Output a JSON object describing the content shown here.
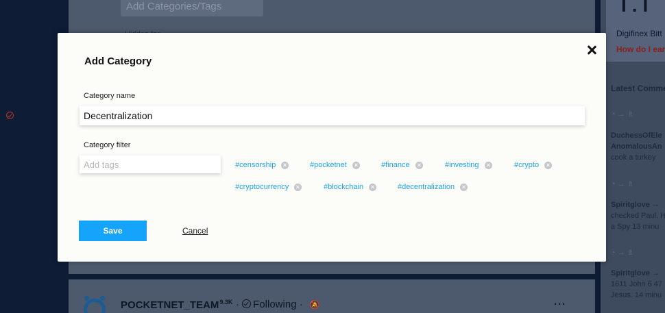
{
  "background": {
    "input_text": "Add Categories/Tags",
    "small_text": "Hidden for",
    "post": {
      "author": "POCKETNET_TEAM",
      "score": "9.3K",
      "separator": "·",
      "following": "Following",
      "bell_icon": "bell-off-icon",
      "more": "···"
    },
    "right_column": {
      "big_text": "I.I",
      "exchanges": "Digifinex  Bitt",
      "link": "How do I earn",
      "heading": "Latest Comme",
      "arrow_row": "◔ → ♗",
      "comments": [
        {
          "user": "DuchessOfEle",
          "line2": "AnomalousAn",
          "line3": "cook a turkey"
        },
        {
          "user": "Spiritglove →",
          "line2": "checked Paul, H",
          "line3": "a Spy 13 minu"
        },
        {
          "user": "Spiritglove →",
          "line2": "1611 John 6 47",
          "line3": "Jesus. 14 minu"
        }
      ]
    }
  },
  "modal": {
    "title": "Add Category",
    "close_icon": "close-icon",
    "category_name_label": "Category name",
    "category_name_value": "Decentralization",
    "category_filter_label": "Category filter",
    "tags_placeholder": "Add tags",
    "tags": [
      "#censorship",
      "#pocketnet",
      "#finance",
      "#investing",
      "#crypto",
      "#cryptocurrency",
      "#blockchain",
      "#decentralization"
    ],
    "save_label": "Save",
    "cancel_label": "Cancel"
  },
  "colors": {
    "accent": "#16a4fb",
    "tag_text": "#1fa2e6",
    "modal_bg": "#fcfcf8",
    "page_bg": "#0d1c34"
  }
}
